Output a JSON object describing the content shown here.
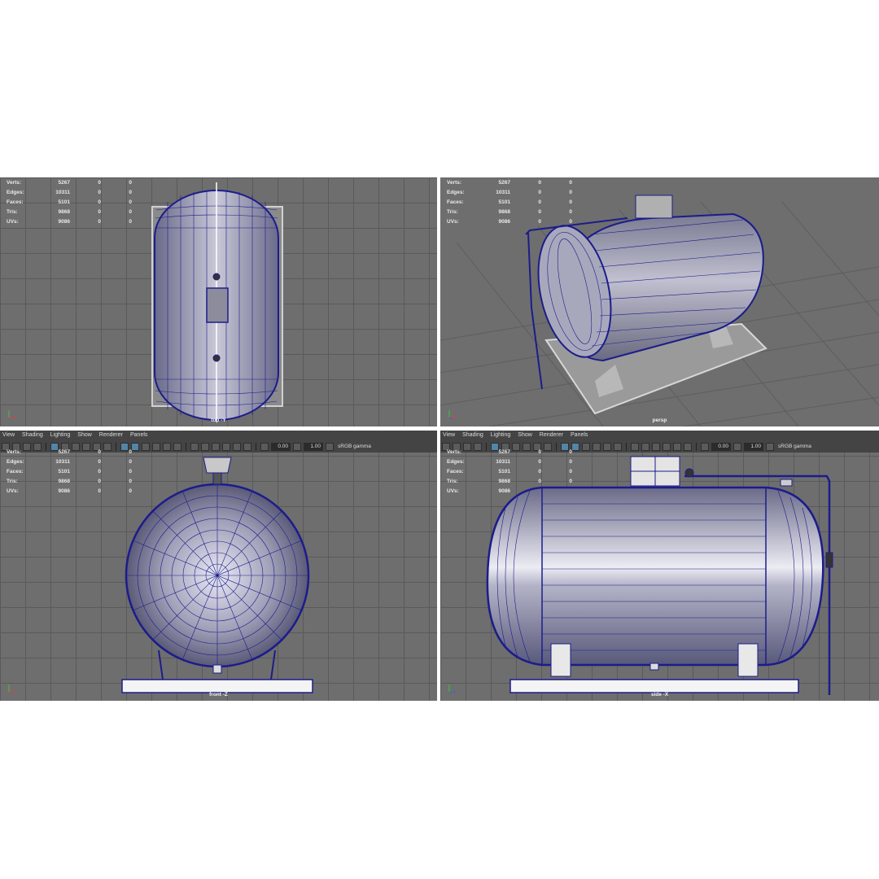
{
  "menu": [
    "View",
    "Shading",
    "Lighting",
    "Show",
    "Renderer",
    "Panels"
  ],
  "toolbar": {
    "exposure": "0.00",
    "gamma": "1.00",
    "colorspace": "sRGB gamma"
  },
  "hud": [
    {
      "label": "Verts:",
      "value": "5267",
      "a": "0",
      "b": "0"
    },
    {
      "label": "Edges:",
      "value": "10311",
      "a": "0",
      "b": "0"
    },
    {
      "label": "Faces:",
      "value": "5101",
      "a": "0",
      "b": "0"
    },
    {
      "label": "Tris:",
      "value": "9868",
      "a": "0",
      "b": "0"
    },
    {
      "label": "UVs:",
      "value": "9086",
      "a": "0",
      "b": "0"
    }
  ],
  "viewports": {
    "top": {
      "name": "top -Y"
    },
    "persp": {
      "name": "persp"
    },
    "front": {
      "name": "front -Z"
    },
    "side": {
      "name": "side -X"
    }
  },
  "colors": {
    "wire": "#1c1c8c",
    "grid": "#5a5a5a",
    "bg": "#6e6e6e",
    "panel": "#444444"
  }
}
